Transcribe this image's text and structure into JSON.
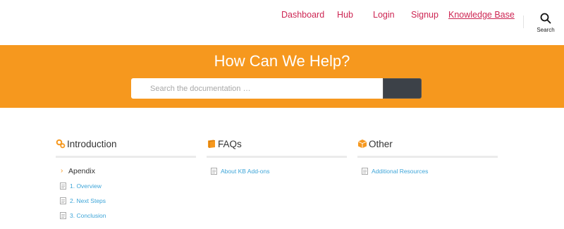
{
  "nav": {
    "items": [
      {
        "label": "Dashboard"
      },
      {
        "label": "Hub"
      },
      {
        "label": "Login"
      },
      {
        "label": "Signup"
      },
      {
        "label": "Knowledge Base",
        "active": true
      }
    ],
    "search_label": "Search"
  },
  "hero": {
    "title": "How Can We Help?",
    "search_placeholder": "Search the documentation …",
    "bg_color": "#f6981e"
  },
  "sections": [
    {
      "title": "Introduction",
      "icon": "gears-icon",
      "folder": "Apendix",
      "docs": [
        "1. Overview",
        "2. Next Steps",
        "3. Conclusion"
      ]
    },
    {
      "title": "FAQs",
      "icon": "book-icon",
      "docs": [
        "About KB Add-ons"
      ]
    },
    {
      "title": "Other",
      "icon": "box-icon",
      "docs": [
        "Additional Resources"
      ]
    }
  ],
  "colors": {
    "accent": "#cd2653",
    "link": "#3ea5d8",
    "hero": "#f6981e"
  }
}
